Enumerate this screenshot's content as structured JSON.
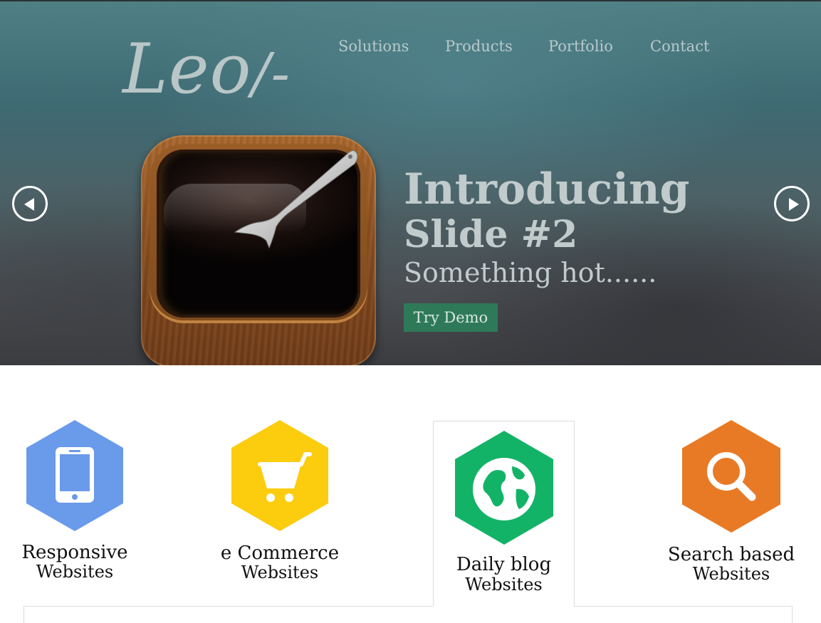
{
  "brand": {
    "logo_text": "Leo",
    "logo_suffix": "/-"
  },
  "nav": {
    "items": [
      {
        "label": "Solutions"
      },
      {
        "label": "Products"
      },
      {
        "label": "Portfolio"
      },
      {
        "label": "Contact"
      }
    ]
  },
  "slider": {
    "title": "Introducing",
    "subtitle": "Slide #2",
    "tagline": "Something hot......",
    "cta_label": "Try Demo",
    "prev_icon": "chevron-left-circle-icon",
    "next_icon": "chevron-right-circle-icon",
    "image": "coffee-app-icon"
  },
  "features": [
    {
      "title": "Responsive",
      "subtitle": "Websites",
      "icon": "mobile-phone-icon",
      "color": "#6a9aea",
      "active": false
    },
    {
      "title": "e Commerce",
      "subtitle": "Websites",
      "icon": "shopping-cart-icon",
      "color": "#fccc0e",
      "active": false
    },
    {
      "title": "Daily blog",
      "subtitle": "Websites",
      "icon": "globe-icon",
      "color": "#13b367",
      "active": true
    },
    {
      "title": "Search based",
      "subtitle": "Websites",
      "icon": "search-icon",
      "color": "#e87a26",
      "active": false
    }
  ],
  "colors": {
    "cta_green": "#2e7a58",
    "hero_text": "#c1cbcc",
    "nav_text": "#b8c9cb"
  }
}
